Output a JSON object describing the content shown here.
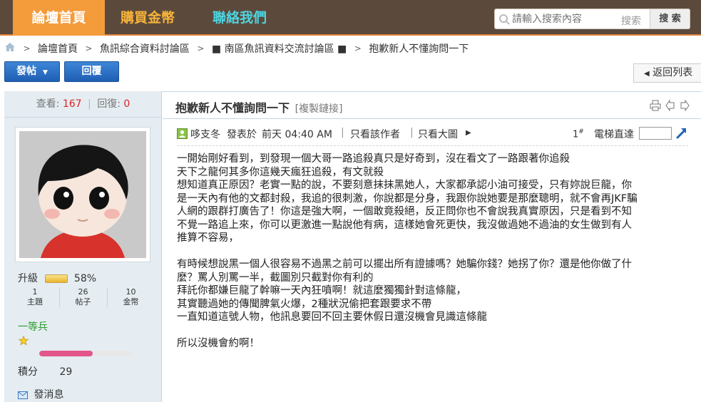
{
  "nav": {
    "home": "論壇首頁",
    "buy": "購買金幣",
    "contact": "聯絡我們"
  },
  "search": {
    "placeholder": "請輸入搜索內容",
    "hint": "搜索",
    "button": "搜 索"
  },
  "breadcrumb": [
    "論壇首頁",
    "魚訊綜合資料討論區",
    "■ 南區魚訊資料交流討論區 ■",
    "抱歉新人不懂詢問一下"
  ],
  "actions": {
    "post": "發帖",
    "reply": "回覆",
    "back": "返回列表"
  },
  "stats": {
    "views_label": "查看:",
    "views": "167",
    "replies_label": "回復:",
    "replies": "0"
  },
  "author": {
    "level_label": "升級",
    "level_percent": "58%",
    "counts": [
      {
        "value": "1",
        "label": "主題"
      },
      {
        "value": "26",
        "label": "帖子"
      },
      {
        "value": "10",
        "label": "金幣"
      }
    ],
    "rank": "一等兵",
    "rank_progress": 0.58,
    "points_label": "積分",
    "points": "29",
    "message": "發消息"
  },
  "post": {
    "title": "抱歉新人不懂詢問一下",
    "copy_link": "[複製鏈接]",
    "author_name": "哆支冬",
    "posted_label": "發表於",
    "time": "前天 04:40 AM",
    "only_author": "只看該作者",
    "only_images": "只看大圖",
    "floor": "1",
    "floor_mark": "#",
    "jump_label": "電梯直達",
    "lines": [
      "一開始剛好看到，到發現一個大哥一路追殺真只是好奇到，沒在看文了一路跟著你追殺",
      "天下之龍何其多你這幾天瘋狂追殺，有文就殺",
      "想知道真正原因？老實一點的說，不要刻意抹抹黑她人，大家都承認小油可接受，只有妳說巨龍，你",
      "是一天內有他的文都封殺，我追的很刺激，你說都是分身，我跟你說她要是那麼聰明，就不會再JKF騙",
      "人網的跟群打廣告了！你這是強大啊，一個敢竟殺絕，反正問你也不會說我真實原因，只是看到不知",
      "不覺一路追上來，你可以更激進一點說他有病，這樣她會死更快，我沒做過她不過油的女生做到有人",
      "推算不容易，",
      "",
      "有時候想說黑一個人很容易不過黑之前可以擺出所有證據嗎？她騙你錢？她拐了你？還是他你做了什",
      "麼？罵人別罵一半，截圖別只截對你有利的",
      "拜託你都嫌巨龍了幹嘛一天內狂噴啊！就這麼獨獨針對這條龍，",
      "其實聽過她的傳聞脾氣火爆，2種狀況偷把套跟要求不帶",
      "一直知道這號人物，他訊息要回不回主要休假日還沒機會見識這條龍",
      "",
      "所以沒機會約啊！"
    ]
  }
}
